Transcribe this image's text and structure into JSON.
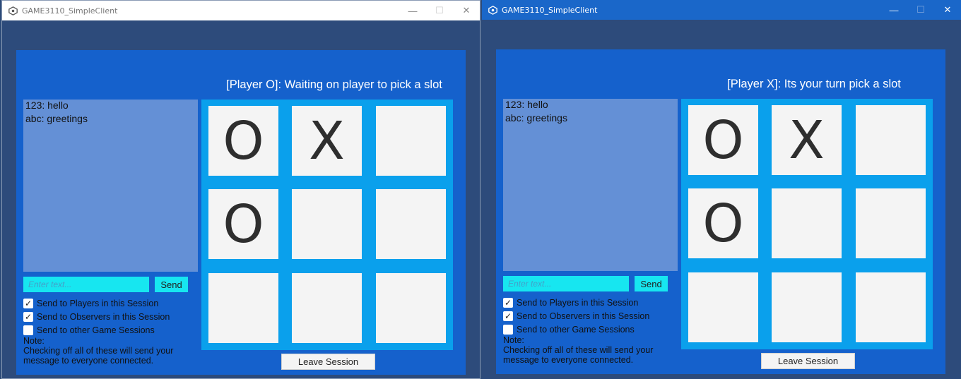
{
  "windows": [
    {
      "title": "GAME3110_SimpleClient",
      "controls": {
        "minimize": "—",
        "maximize": "☐",
        "close": "✕"
      },
      "status": "[Player O]: Waiting on player to pick a slot",
      "chat": [
        "123: hello",
        "abc: greetings"
      ],
      "input_placeholder": "Enter text...",
      "send_label": "Send",
      "checks": [
        {
          "label": "Send to Players in this Session",
          "checked": true,
          "mark": "✓"
        },
        {
          "label": "Send to Observers in this Session",
          "checked": true,
          "mark": "✓"
        },
        {
          "label": "Send to other Game Sessions",
          "checked": false,
          "mark": ""
        }
      ],
      "note": [
        "Note:",
        "Checking off all of these will send your",
        "message to everyone connected."
      ],
      "board": [
        "O",
        "X",
        "",
        "O",
        "",
        "",
        "",
        "",
        ""
      ],
      "leave_label": "Leave Session"
    },
    {
      "title": "GAME3110_SimpleClient",
      "controls": {
        "minimize": "—",
        "maximize": "☐",
        "close": "✕"
      },
      "status": "[Player X]: Its your turn pick a slot",
      "chat": [
        "123: hello",
        "abc: greetings"
      ],
      "input_placeholder": "Enter text...",
      "send_label": "Send",
      "checks": [
        {
          "label": "Send to Players in this Session",
          "checked": true,
          "mark": "✓"
        },
        {
          "label": "Send to Observers in this Session",
          "checked": true,
          "mark": "✓"
        },
        {
          "label": "Send to other Game Sessions",
          "checked": false,
          "mark": ""
        }
      ],
      "note": [
        "Note:",
        "Checking off all of these will send your",
        "message to everyone connected."
      ],
      "board": [
        "O",
        "X",
        "",
        "O",
        "",
        "",
        "",
        "",
        ""
      ],
      "leave_label": "Leave Session"
    }
  ]
}
